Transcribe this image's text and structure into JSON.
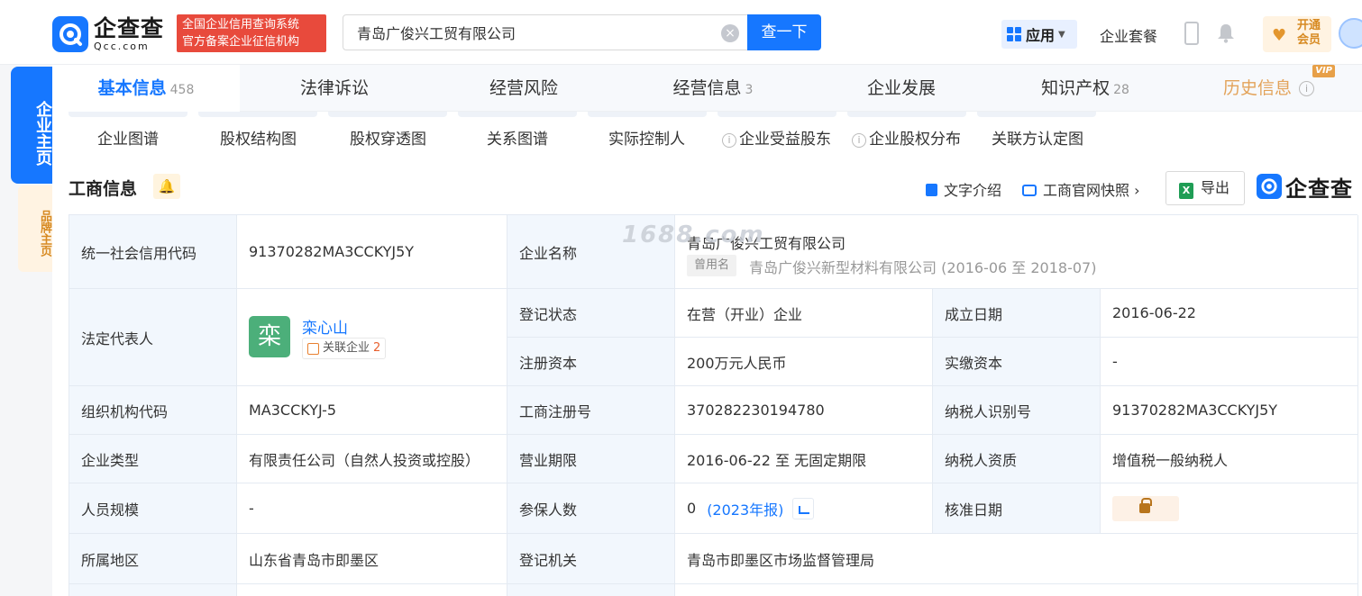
{
  "header": {
    "logo_cn": "企查查",
    "logo_en": "Qcc.com",
    "badge_line1": "全国企业信用查询系统",
    "badge_line2": "官方备案企业征信机构",
    "search_value": "青岛广俊兴工贸有限公司",
    "search_button": "查一下",
    "app_label": "应用",
    "package_label": "企业套餐",
    "vip_line1": "开通",
    "vip_line2": "会员"
  },
  "left_tabs": {
    "main": "企业主页",
    "brand": "品牌主页"
  },
  "tabs": [
    {
      "label": "基本信息",
      "count": "458"
    },
    {
      "label": "法律诉讼",
      "count": ""
    },
    {
      "label": "经营风险",
      "count": ""
    },
    {
      "label": "经营信息",
      "count": "3"
    },
    {
      "label": "企业发展",
      "count": ""
    },
    {
      "label": "知识产权",
      "count": "28"
    },
    {
      "label": "历史信息",
      "count": "",
      "badge": "VIP"
    }
  ],
  "subnav": [
    "企业图谱",
    "股权结构图",
    "股权穿透图",
    "关系图谱",
    "实际控制人",
    "企业受益股东",
    "企业股权分布",
    "关联方认定图"
  ],
  "section": {
    "title": "工商信息",
    "text_intro": "文字介绍",
    "snapshot": "工商官网快照",
    "export": "导出",
    "brand_mark": "企查查"
  },
  "watermark": "1688.com",
  "table": {
    "credit_code_label": "统一社会信用代码",
    "credit_code": "91370282MA3CCKYJ5Y",
    "company_name_label": "企业名称",
    "company_name": "青岛广俊兴工贸有限公司",
    "former_tag": "曾用名",
    "former_name": "青岛广俊兴新型材料有限公司 (2016-06 至 2018-07)",
    "legal_rep_label": "法定代表人",
    "legal_avatar": "栾",
    "legal_name": "栾心山",
    "related_label": "关联企业",
    "related_count": "2",
    "reg_status_label": "登记状态",
    "reg_status": "在营（开业）企业",
    "founded_label": "成立日期",
    "founded": "2016-06-22",
    "reg_capital_label": "注册资本",
    "reg_capital": "200万元人民币",
    "paid_capital_label": "实缴资本",
    "paid_capital": "-",
    "org_code_label": "组织机构代码",
    "org_code": "MA3CCKYJ-5",
    "reg_no_label": "工商注册号",
    "reg_no": "370282230194780",
    "taxpayer_id_label": "纳税人识别号",
    "taxpayer_id": "91370282MA3CCKYJ5Y",
    "company_type_label": "企业类型",
    "company_type": "有限责任公司（自然人投资或控股）",
    "term_label": "营业期限",
    "term": "2016-06-22 至 无固定期限",
    "tax_quality_label": "纳税人资质",
    "tax_quality": "增值税一般纳税人",
    "staff_label": "人员规模",
    "staff": "-",
    "insured_label": "参保人数",
    "insured": "0",
    "insured_year": "(2023年报)",
    "approval_label": "核准日期",
    "region_label": "所属地区",
    "region": "山东省青岛市即墨区",
    "authority_label": "登记机关",
    "authority": "青岛市即墨区市场监督管理局"
  },
  "colors": {
    "brand_blue": "#1677ff",
    "label_bg": "#f2f7fd",
    "badge_red": "#e84a3c",
    "vip_orange": "#d78a22"
  }
}
